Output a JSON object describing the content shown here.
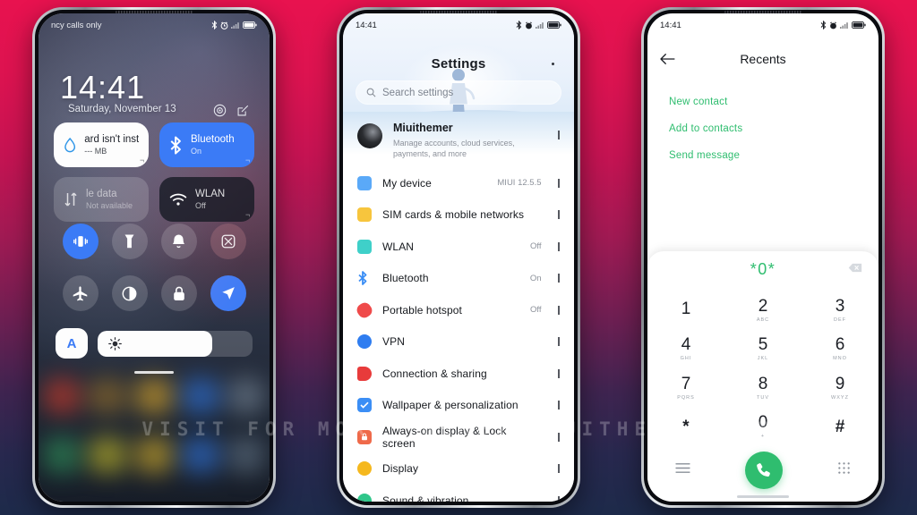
{
  "watermark": "VISIT FOR MORE THEMES MIUITHEMER.COM",
  "background": {
    "top_color": "#e8124f",
    "bottom_color": "#1d2a4a"
  },
  "phone1": {
    "name": "lock-screen-control-center",
    "statusbar": {
      "carrier": "ncy calls only",
      "icons": [
        "bluetooth-icon",
        "alarm-icon",
        "signal-icon",
        "battery-icon"
      ]
    },
    "clock": {
      "time": "14:41",
      "date": "Saturday, November 13"
    },
    "clock_icons": [
      "camera-ring-icon",
      "edit-icon"
    ],
    "tiles": [
      {
        "title": "ard isn't install",
        "subtitle": "--- MB",
        "icon": "water-drop-icon",
        "style": "white"
      },
      {
        "title": "Bluetooth",
        "subtitle": "On",
        "icon": "bluetooth-icon",
        "style": "blue"
      },
      {
        "title": "le data",
        "subtitle": "Not available",
        "icon": "data-transfer-icon",
        "style": "dim"
      },
      {
        "title": "WLAN",
        "subtitle": "Off",
        "icon": "wifi-icon",
        "style": "dark"
      }
    ],
    "toggles": [
      {
        "name": "vibrate-toggle",
        "icon": "vibrate-icon",
        "state": "on"
      },
      {
        "name": "flashlight-toggle",
        "icon": "flashlight-icon",
        "state": "off"
      },
      {
        "name": "ringer-toggle",
        "icon": "bell-icon",
        "state": "off"
      },
      {
        "name": "screenshot-toggle",
        "icon": "screenshot-icon",
        "state": "warm"
      },
      {
        "name": "airplane-mode-toggle",
        "icon": "airplane-icon",
        "state": "off"
      },
      {
        "name": "dark-mode-toggle",
        "icon": "contrast-icon",
        "state": "off"
      },
      {
        "name": "lock-toggle",
        "icon": "lock-icon",
        "state": "off"
      },
      {
        "name": "location-toggle",
        "icon": "location-arrow-icon",
        "state": "on"
      }
    ],
    "brightness": {
      "auto_label": "A",
      "icon": "brightness-icon",
      "level": 74
    }
  },
  "phone2": {
    "name": "settings-screen",
    "statusbar": {
      "time": "14:41",
      "icons": [
        "bluetooth-icon",
        "alarm-icon",
        "signal-icon",
        "battery-icon"
      ]
    },
    "title": "Settings",
    "search": {
      "placeholder": "Search settings",
      "icon": "search-icon"
    },
    "account": {
      "name": "Miuithemer",
      "subtitle": "Manage accounts, cloud services, payments, and more"
    },
    "rows": [
      {
        "label": "My device",
        "value": "MIUI 12.5.5",
        "color": "#5aa9f8"
      },
      {
        "label": "SIM cards & mobile networks",
        "value": "",
        "color": "#f6c council"
      },
      {
        "label": "WLAN",
        "value": "Off",
        "color": "#3fd0c9"
      },
      {
        "label": "Bluetooth",
        "value": "On",
        "color": "#3b8ef5"
      },
      {
        "label": "Portable hotspot",
        "value": "Off",
        "color": "#ef4a4a"
      },
      {
        "label": "VPN",
        "value": "",
        "color": "#2f7df0"
      },
      {
        "label": "Connection & sharing",
        "value": "",
        "color": "#e83b3b"
      },
      {
        "label": "Wallpaper & personalization",
        "value": "",
        "color": "#3b8ef5"
      },
      {
        "label": "Always-on display & Lock screen",
        "value": "",
        "color": "#ef6a4a"
      },
      {
        "label": "Display",
        "value": "",
        "color": "#f5b81e"
      },
      {
        "label": "Sound & vibration",
        "value": "",
        "color": "#2fc68a"
      }
    ]
  },
  "phone3": {
    "name": "dialer-recents-screen",
    "statusbar": {
      "time": "14:41",
      "icons": [
        "bluetooth-icon",
        "alarm-icon",
        "signal-icon",
        "battery-icon"
      ]
    },
    "title": "Recents",
    "back_icon": "back-arrow-icon",
    "actions": [
      "New contact",
      "Add to contacts",
      "Send message"
    ],
    "entry": {
      "number": "*0*",
      "backspace_icon": "backspace-icon"
    },
    "keypad": [
      {
        "digit": "1",
        "letters": ""
      },
      {
        "digit": "2",
        "letters": "ABC"
      },
      {
        "digit": "3",
        "letters": "DEF"
      },
      {
        "digit": "4",
        "letters": "GHI"
      },
      {
        "digit": "5",
        "letters": "JKL"
      },
      {
        "digit": "6",
        "letters": "MNO"
      },
      {
        "digit": "7",
        "letters": "PQRS"
      },
      {
        "digit": "8",
        "letters": "TUV"
      },
      {
        "digit": "9",
        "letters": "WXYZ"
      },
      {
        "digit": "*",
        "letters": ""
      },
      {
        "digit": "0",
        "letters": "+"
      },
      {
        "digit": "#",
        "letters": ""
      }
    ],
    "bottom": {
      "menu_icon": "menu-icon",
      "call_icon": "call-icon",
      "keypad_icon": "keypad-icon"
    },
    "accent_color": "#2fbd6f"
  }
}
